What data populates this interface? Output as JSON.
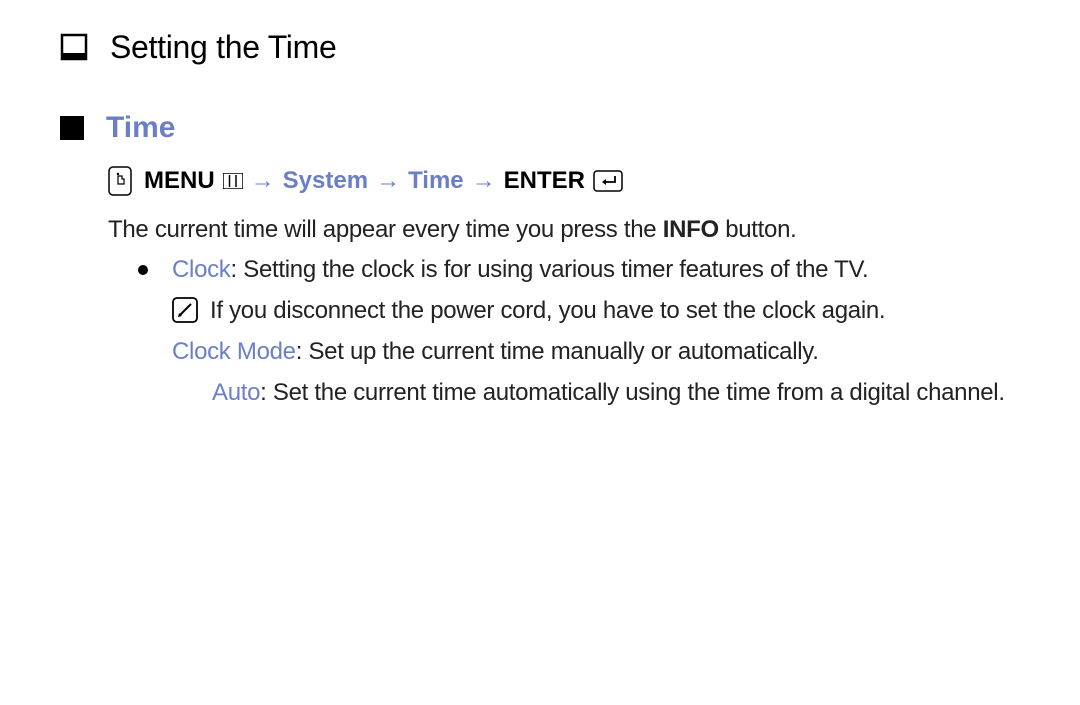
{
  "title": "Setting the Time",
  "section": "Time",
  "nav": {
    "menu": "MENU",
    "path1": "System",
    "path2": "Time",
    "enter": "ENTER",
    "arrow": "→"
  },
  "intro_pre": "The current time will appear every time you press the ",
  "intro_bold": "INFO",
  "intro_post": " button.",
  "clock": {
    "label": "Clock",
    "desc": ": Setting the clock is for using various timer features of the TV.",
    "note": "If you disconnect the power cord, you have to set the clock again.",
    "mode_label": "Clock Mode",
    "mode_desc": ": Set up the current time manually or automatically.",
    "auto_label": "Auto",
    "auto_desc": ": Set the current time automatically using the time from a digital channel."
  }
}
